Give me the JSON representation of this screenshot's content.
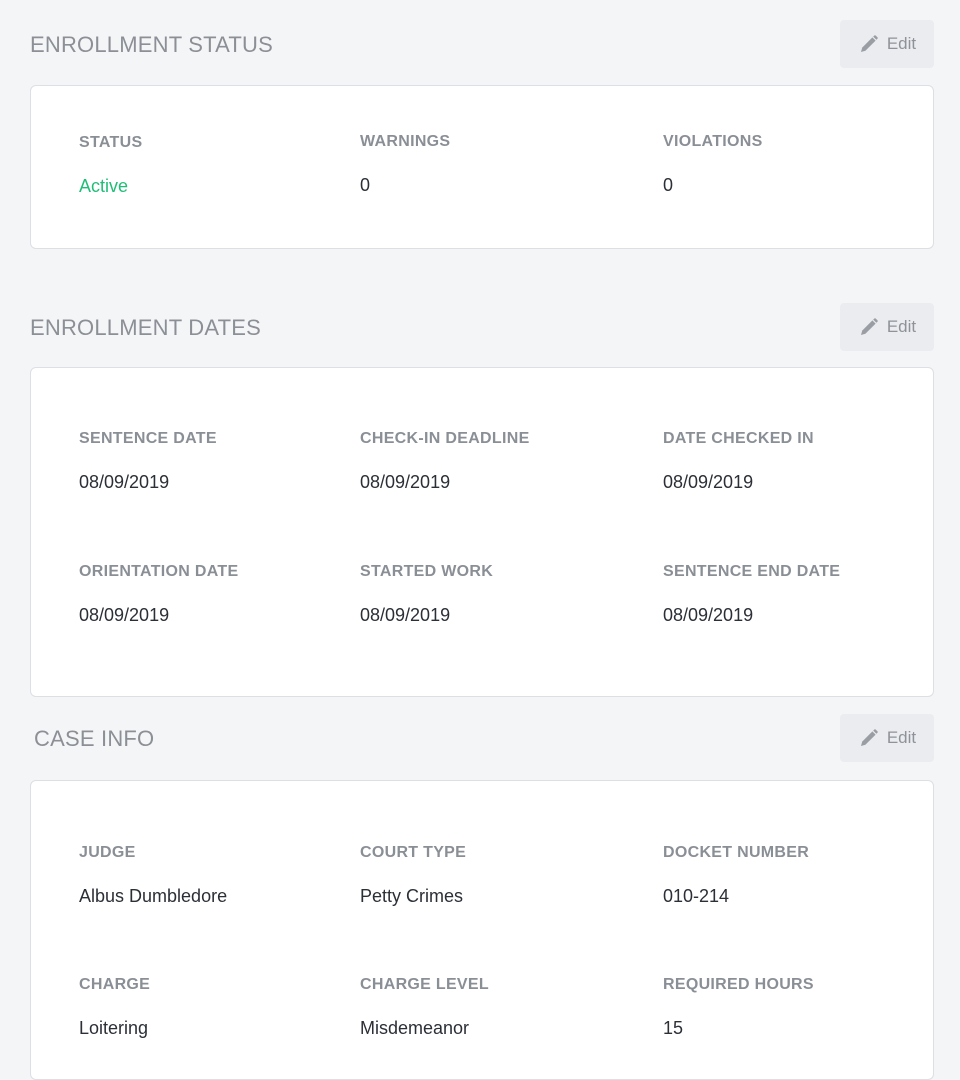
{
  "enrollment_status": {
    "title": "ENROLLMENT STATUS",
    "edit_label": "Edit",
    "fields": [
      {
        "label": "STATUS",
        "value": "Active"
      },
      {
        "label": "WARNINGS",
        "value": "0"
      },
      {
        "label": "VIOLATIONS",
        "value": "0"
      }
    ]
  },
  "enrollment_dates": {
    "title": "ENROLLMENT DATES",
    "edit_label": "Edit",
    "fields": [
      {
        "label": "SENTENCE DATE",
        "value": "08/09/2019"
      },
      {
        "label": "CHECK-IN DEADLINE",
        "value": "08/09/2019"
      },
      {
        "label": "DATE CHECKED IN",
        "value": "08/09/2019"
      },
      {
        "label": "ORIENTATION DATE",
        "value": "08/09/2019"
      },
      {
        "label": "STARTED WORK",
        "value": "08/09/2019"
      },
      {
        "label": "SENTENCE END DATE",
        "value": "08/09/2019"
      }
    ]
  },
  "case_info": {
    "title": "CASE INFO",
    "edit_label": "Edit",
    "fields": [
      {
        "label": "JUDGE",
        "value": "Albus Dumbledore"
      },
      {
        "label": "COURT TYPE",
        "value": "Petty Crimes"
      },
      {
        "label": "DOCKET NUMBER",
        "value": "010-214"
      },
      {
        "label": "CHARGE",
        "value": "Loitering"
      },
      {
        "label": "CHARGE LEVEL",
        "value": "Misdemeanor"
      },
      {
        "label": "REQUIRED HOURS",
        "value": "15"
      }
    ]
  },
  "icons": {
    "edit": "pencil-icon"
  },
  "colors": {
    "status_active": "#1fbe77",
    "label": "#8a8f96",
    "section_title": "#8c9096"
  }
}
